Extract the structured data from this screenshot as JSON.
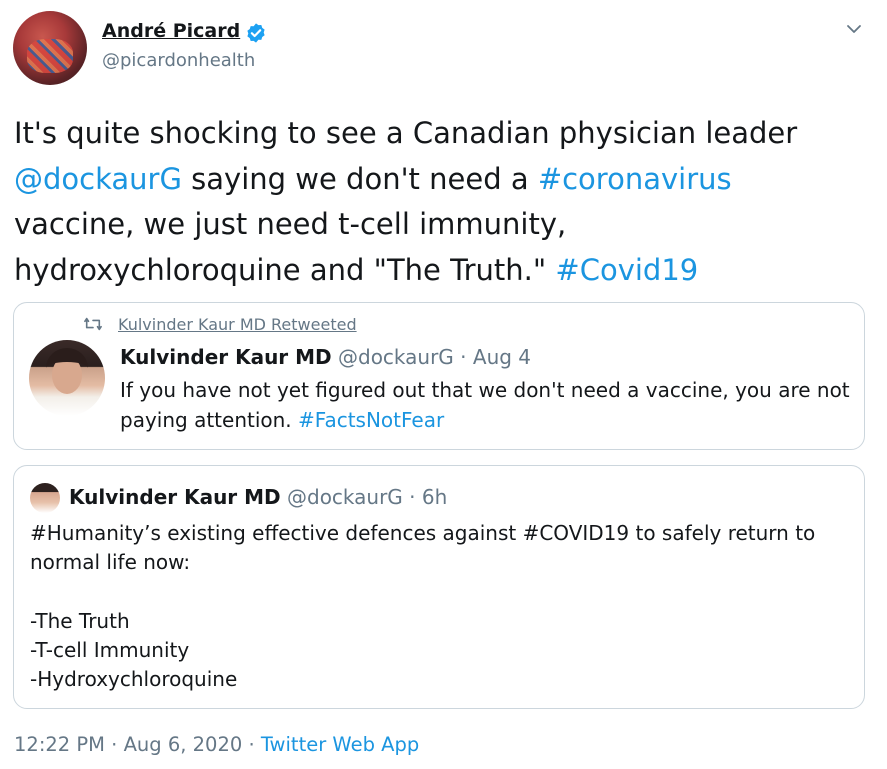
{
  "tweet": {
    "author_name": "André Picard",
    "author_handle": "@picardonhealth",
    "body": {
      "l1": "It's quite shocking to see a Canadian physician leader",
      "l2_mention": "@dockaurG",
      "l2_text": " saying we don't need a ",
      "l2_hashtag": "#coronavirus",
      "l3": "vaccine, we just need t-cell immunity,",
      "l4_text": "hydroxychloroquine and \"The Truth.\" ",
      "l4_hashtag": "#Covid19"
    },
    "timestamp": "12:22 PM · Aug 6, 2020 · ",
    "source": "Twitter Web App"
  },
  "retweet_card": {
    "retweeted_by": "Kulvinder Kaur MD Retweeted",
    "name": "Kulvinder Kaur MD",
    "meta": " @dockaurG · Aug 4",
    "line1": "If you have not yet figured out that we don't need a vaccine, you are not",
    "line2_text": "paying attention. ",
    "line2_hashtag": "#FactsNotFear"
  },
  "quote_card": {
    "name": "Kulvinder Kaur MD",
    "meta": " @dockaurG · 6h",
    "lines": [
      "#Humanity’s existing effective defences against #COVID19 to safely return to",
      "normal life now:",
      "",
      "-The Truth",
      "-T-cell Immunity",
      "-Hydroxychloroquine"
    ]
  },
  "colors": {
    "link": "#1b95e0",
    "secondary_text": "#657786",
    "border": "#ccd6dd",
    "verified": "#1da1f2"
  },
  "icons": [
    "verified-badge-icon",
    "chevron-down-icon",
    "retweet-icon"
  ]
}
